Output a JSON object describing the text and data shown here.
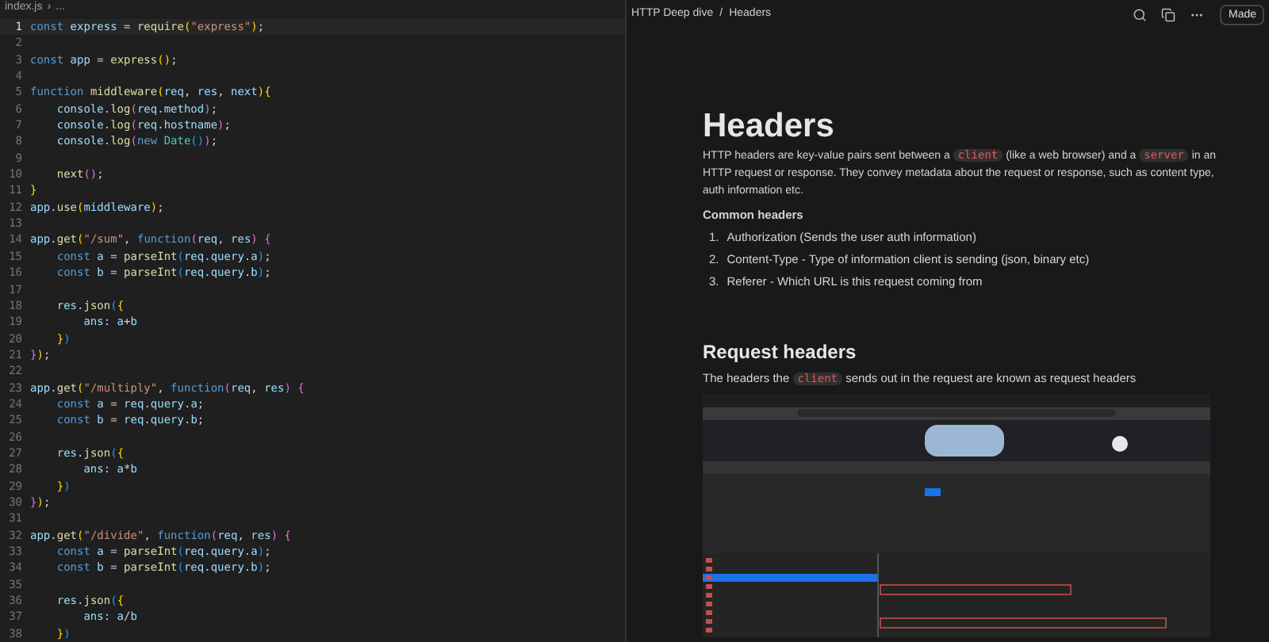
{
  "editor": {
    "breadcrumb": [
      {
        "text": "index.js"
      },
      {
        "text": "›"
      },
      {
        "text": "..."
      }
    ],
    "lines": [
      {
        "n": "1",
        "current": true,
        "t": [
          {
            "text": "const ",
            "kind": "keyword"
          },
          {
            "text": "express",
            "kind": "variable"
          },
          {
            "text": " = ",
            "kind": "punct"
          },
          {
            "text": "require",
            "kind": "function"
          },
          {
            "text": "(",
            "kind": "bracket1"
          },
          {
            "text": "\"express\"",
            "kind": "string"
          },
          {
            "text": ")",
            "kind": "bracket1"
          },
          {
            "text": ";",
            "kind": "punct"
          }
        ]
      },
      {
        "n": "2",
        "current": false
      },
      {
        "n": "3",
        "current": false,
        "t": [
          {
            "text": "const ",
            "kind": "keyword"
          },
          {
            "text": "app",
            "kind": "variable"
          },
          {
            "text": " = ",
            "kind": "punct"
          },
          {
            "text": "express",
            "kind": "function"
          },
          {
            "text": "()",
            "kind": "bracket1"
          },
          {
            "text": ";",
            "kind": "punct"
          }
        ]
      },
      {
        "n": "4",
        "current": false
      },
      {
        "n": "5",
        "current": false,
        "t": [
          {
            "text": "function ",
            "kind": "keyword"
          },
          {
            "text": "middleware",
            "kind": "function"
          },
          {
            "text": "(",
            "kind": "bracket1"
          },
          {
            "text": "req",
            "kind": "variable"
          },
          {
            "text": ", ",
            "kind": "punct"
          },
          {
            "text": "res",
            "kind": "variable"
          },
          {
            "text": ", ",
            "kind": "punct"
          },
          {
            "text": "next",
            "kind": "variable"
          },
          {
            "text": ")",
            "kind": "bracket1"
          },
          {
            "text": "{",
            "kind": "bracket1"
          }
        ]
      },
      {
        "n": "6",
        "current": false,
        "t": [
          {
            "text": "    console",
            "kind": "variable"
          },
          {
            "text": ".",
            "kind": "punct"
          },
          {
            "text": "log",
            "kind": "function"
          },
          {
            "text": "(",
            "kind": "bracket2"
          },
          {
            "text": "req",
            "kind": "variable"
          },
          {
            "text": ".",
            "kind": "punct"
          },
          {
            "text": "method",
            "kind": "variable"
          },
          {
            "text": ")",
            "kind": "bracket2"
          },
          {
            "text": ";",
            "kind": "punct"
          }
        ]
      },
      {
        "n": "7",
        "current": false,
        "t": [
          {
            "text": "    console",
            "kind": "variable"
          },
          {
            "text": ".",
            "kind": "punct"
          },
          {
            "text": "log",
            "kind": "function"
          },
          {
            "text": "(",
            "kind": "bracket2"
          },
          {
            "text": "req",
            "kind": "variable"
          },
          {
            "text": ".",
            "kind": "punct"
          },
          {
            "text": "hostname",
            "kind": "variable"
          },
          {
            "text": ")",
            "kind": "bracket2"
          },
          {
            "text": ";",
            "kind": "punct"
          }
        ]
      },
      {
        "n": "8",
        "current": false,
        "t": [
          {
            "text": "    console",
            "kind": "variable"
          },
          {
            "text": ".",
            "kind": "punct"
          },
          {
            "text": "log",
            "kind": "function"
          },
          {
            "text": "(",
            "kind": "bracket2"
          },
          {
            "text": "new ",
            "kind": "keyword"
          },
          {
            "text": "Date",
            "kind": "class"
          },
          {
            "text": "()",
            "kind": "bracket3"
          },
          {
            "text": ")",
            "kind": "bracket2"
          },
          {
            "text": ";",
            "kind": "punct"
          }
        ]
      },
      {
        "n": "9",
        "current": false
      },
      {
        "n": "10",
        "current": false,
        "t": [
          {
            "text": "    next",
            "kind": "function"
          },
          {
            "text": "()",
            "kind": "bracket2"
          },
          {
            "text": ";",
            "kind": "punct"
          }
        ]
      },
      {
        "n": "11",
        "current": false,
        "t": [
          {
            "text": "}",
            "kind": "bracket1"
          }
        ]
      },
      {
        "n": "12",
        "current": false,
        "t": [
          {
            "text": "app",
            "kind": "variable"
          },
          {
            "text": ".",
            "kind": "punct"
          },
          {
            "text": "use",
            "kind": "function"
          },
          {
            "text": "(",
            "kind": "bracket1"
          },
          {
            "text": "middleware",
            "kind": "variable"
          },
          {
            "text": ")",
            "kind": "bracket1"
          },
          {
            "text": ";",
            "kind": "punct"
          }
        ]
      },
      {
        "n": "13",
        "current": false
      },
      {
        "n": "14",
        "current": false,
        "t": [
          {
            "text": "app",
            "kind": "variable"
          },
          {
            "text": ".",
            "kind": "punct"
          },
          {
            "text": "get",
            "kind": "function"
          },
          {
            "text": "(",
            "kind": "bracket1"
          },
          {
            "text": "\"/sum\"",
            "kind": "string"
          },
          {
            "text": ", ",
            "kind": "punct"
          },
          {
            "text": "function",
            "kind": "keyword"
          },
          {
            "text": "(",
            "kind": "bracket2"
          },
          {
            "text": "req",
            "kind": "variable"
          },
          {
            "text": ", ",
            "kind": "punct"
          },
          {
            "text": "res",
            "kind": "variable"
          },
          {
            "text": ") {",
            "kind": "bracket2"
          }
        ]
      },
      {
        "n": "15",
        "current": false,
        "t": [
          {
            "text": "    const ",
            "kind": "keyword"
          },
          {
            "text": "a",
            "kind": "variable"
          },
          {
            "text": " = ",
            "kind": "punct"
          },
          {
            "text": "parseInt",
            "kind": "function"
          },
          {
            "text": "(",
            "kind": "bracket3"
          },
          {
            "text": "req",
            "kind": "variable"
          },
          {
            "text": ".",
            "kind": "punct"
          },
          {
            "text": "query",
            "kind": "variable"
          },
          {
            "text": ".",
            "kind": "punct"
          },
          {
            "text": "a",
            "kind": "variable"
          },
          {
            "text": ")",
            "kind": "bracket3"
          },
          {
            "text": ";",
            "kind": "punct"
          }
        ]
      },
      {
        "n": "16",
        "current": false,
        "t": [
          {
            "text": "    const ",
            "kind": "keyword"
          },
          {
            "text": "b",
            "kind": "variable"
          },
          {
            "text": " = ",
            "kind": "punct"
          },
          {
            "text": "parseInt",
            "kind": "function"
          },
          {
            "text": "(",
            "kind": "bracket3"
          },
          {
            "text": "req",
            "kind": "variable"
          },
          {
            "text": ".",
            "kind": "punct"
          },
          {
            "text": "query",
            "kind": "variable"
          },
          {
            "text": ".",
            "kind": "punct"
          },
          {
            "text": "b",
            "kind": "variable"
          },
          {
            "text": ")",
            "kind": "bracket3"
          },
          {
            "text": ";",
            "kind": "punct"
          }
        ]
      },
      {
        "n": "17",
        "current": false
      },
      {
        "n": "18",
        "current": false,
        "t": [
          {
            "text": "    res",
            "kind": "variable"
          },
          {
            "text": ".",
            "kind": "punct"
          },
          {
            "text": "json",
            "kind": "function"
          },
          {
            "text": "(",
            "kind": "bracket3"
          },
          {
            "text": "{",
            "kind": "bracket1"
          }
        ]
      },
      {
        "n": "19",
        "current": false,
        "t": [
          {
            "text": "        ans",
            "kind": "variable"
          },
          {
            "text": ": ",
            "kind": "punct"
          },
          {
            "text": "a",
            "kind": "variable"
          },
          {
            "text": "+",
            "kind": "punct"
          },
          {
            "text": "b",
            "kind": "variable"
          }
        ]
      },
      {
        "n": "20",
        "current": false,
        "t": [
          {
            "text": "    }",
            "kind": "bracket1"
          },
          {
            "text": ")",
            "kind": "bracket3"
          }
        ]
      },
      {
        "n": "21",
        "current": false,
        "t": [
          {
            "text": "}",
            "kind": "bracket2"
          },
          {
            "text": ")",
            "kind": "bracket1"
          },
          {
            "text": ";",
            "kind": "punct"
          }
        ]
      },
      {
        "n": "22",
        "current": false
      },
      {
        "n": "23",
        "current": false,
        "t": [
          {
            "text": "app",
            "kind": "variable"
          },
          {
            "text": ".",
            "kind": "punct"
          },
          {
            "text": "get",
            "kind": "function"
          },
          {
            "text": "(",
            "kind": "bracket1"
          },
          {
            "text": "\"/multiply\"",
            "kind": "string"
          },
          {
            "text": ", ",
            "kind": "punct"
          },
          {
            "text": "function",
            "kind": "keyword"
          },
          {
            "text": "(",
            "kind": "bracket2"
          },
          {
            "text": "req",
            "kind": "variable"
          },
          {
            "text": ", ",
            "kind": "punct"
          },
          {
            "text": "res",
            "kind": "variable"
          },
          {
            "text": ") {",
            "kind": "bracket2"
          }
        ]
      },
      {
        "n": "24",
        "current": false,
        "t": [
          {
            "text": "    const ",
            "kind": "keyword"
          },
          {
            "text": "a",
            "kind": "variable"
          },
          {
            "text": " = ",
            "kind": "punct"
          },
          {
            "text": "req",
            "kind": "variable"
          },
          {
            "text": ".",
            "kind": "punct"
          },
          {
            "text": "query",
            "kind": "variable"
          },
          {
            "text": ".",
            "kind": "punct"
          },
          {
            "text": "a",
            "kind": "variable"
          },
          {
            "text": ";",
            "kind": "punct"
          }
        ]
      },
      {
        "n": "25",
        "current": false,
        "t": [
          {
            "text": "    const ",
            "kind": "keyword"
          },
          {
            "text": "b",
            "kind": "variable"
          },
          {
            "text": " = ",
            "kind": "punct"
          },
          {
            "text": "req",
            "kind": "variable"
          },
          {
            "text": ".",
            "kind": "punct"
          },
          {
            "text": "query",
            "kind": "variable"
          },
          {
            "text": ".",
            "kind": "punct"
          },
          {
            "text": "b",
            "kind": "variable"
          },
          {
            "text": ";",
            "kind": "punct"
          }
        ]
      },
      {
        "n": "26",
        "current": false
      },
      {
        "n": "27",
        "current": false,
        "t": [
          {
            "text": "    res",
            "kind": "variable"
          },
          {
            "text": ".",
            "kind": "punct"
          },
          {
            "text": "json",
            "kind": "function"
          },
          {
            "text": "(",
            "kind": "bracket3"
          },
          {
            "text": "{",
            "kind": "bracket1"
          }
        ]
      },
      {
        "n": "28",
        "current": false,
        "t": [
          {
            "text": "        ans",
            "kind": "variable"
          },
          {
            "text": ": ",
            "kind": "punct"
          },
          {
            "text": "a",
            "kind": "variable"
          },
          {
            "text": "*",
            "kind": "punct"
          },
          {
            "text": "b",
            "kind": "variable"
          }
        ]
      },
      {
        "n": "29",
        "current": false,
        "t": [
          {
            "text": "    }",
            "kind": "bracket1"
          },
          {
            "text": ")",
            "kind": "bracket3"
          }
        ]
      },
      {
        "n": "30",
        "current": false,
        "t": [
          {
            "text": "}",
            "kind": "bracket2"
          },
          {
            "text": ")",
            "kind": "bracket1"
          },
          {
            "text": ";",
            "kind": "punct"
          }
        ]
      },
      {
        "n": "31",
        "current": false
      },
      {
        "n": "32",
        "current": false,
        "t": [
          {
            "text": "app",
            "kind": "variable"
          },
          {
            "text": ".",
            "kind": "punct"
          },
          {
            "text": "get",
            "kind": "function"
          },
          {
            "text": "(",
            "kind": "bracket1"
          },
          {
            "text": "\"/divide\"",
            "kind": "string"
          },
          {
            "text": ", ",
            "kind": "punct"
          },
          {
            "text": "function",
            "kind": "keyword"
          },
          {
            "text": "(",
            "kind": "bracket2"
          },
          {
            "text": "req",
            "kind": "variable"
          },
          {
            "text": ", ",
            "kind": "punct"
          },
          {
            "text": "res",
            "kind": "variable"
          },
          {
            "text": ") {",
            "kind": "bracket2"
          }
        ]
      },
      {
        "n": "33",
        "current": false,
        "t": [
          {
            "text": "    const ",
            "kind": "keyword"
          },
          {
            "text": "a",
            "kind": "variable"
          },
          {
            "text": " = ",
            "kind": "punct"
          },
          {
            "text": "parseInt",
            "kind": "function"
          },
          {
            "text": "(",
            "kind": "bracket3"
          },
          {
            "text": "req",
            "kind": "variable"
          },
          {
            "text": ".",
            "kind": "punct"
          },
          {
            "text": "query",
            "kind": "variable"
          },
          {
            "text": ".",
            "kind": "punct"
          },
          {
            "text": "a",
            "kind": "variable"
          },
          {
            "text": ")",
            "kind": "bracket3"
          },
          {
            "text": ";",
            "kind": "punct"
          }
        ]
      },
      {
        "n": "34",
        "current": false,
        "t": [
          {
            "text": "    const ",
            "kind": "keyword"
          },
          {
            "text": "b",
            "kind": "variable"
          },
          {
            "text": " = ",
            "kind": "punct"
          },
          {
            "text": "parseInt",
            "kind": "function"
          },
          {
            "text": "(",
            "kind": "bracket3"
          },
          {
            "text": "req",
            "kind": "variable"
          },
          {
            "text": ".",
            "kind": "punct"
          },
          {
            "text": "query",
            "kind": "variable"
          },
          {
            "text": ".",
            "kind": "punct"
          },
          {
            "text": "b",
            "kind": "variable"
          },
          {
            "text": ")",
            "kind": "bracket3"
          },
          {
            "text": ";",
            "kind": "punct"
          }
        ]
      },
      {
        "n": "35",
        "current": false
      },
      {
        "n": "36",
        "current": false,
        "t": [
          {
            "text": "    res",
            "kind": "variable"
          },
          {
            "text": ".",
            "kind": "punct"
          },
          {
            "text": "json",
            "kind": "function"
          },
          {
            "text": "(",
            "kind": "bracket3"
          },
          {
            "text": "{",
            "kind": "bracket1"
          }
        ]
      },
      {
        "n": "37",
        "current": false,
        "t": [
          {
            "text": "        ans",
            "kind": "variable"
          },
          {
            "text": ": ",
            "kind": "punct"
          },
          {
            "text": "a",
            "kind": "variable"
          },
          {
            "text": "/",
            "kind": "punct"
          },
          {
            "text": "b",
            "kind": "variable"
          }
        ]
      },
      {
        "n": "38",
        "current": false,
        "t": [
          {
            "text": "    }",
            "kind": "bracket1"
          },
          {
            "text": ")",
            "kind": "bracket3"
          }
        ]
      }
    ]
  },
  "doc": {
    "breadcrumb": [
      "HTTP Deep dive",
      "/",
      "Headers"
    ],
    "made_button": "Made",
    "title": "Headers",
    "intro": [
      {
        "kind": "text",
        "text": "HTTP headers are key-value pairs sent between a "
      },
      {
        "kind": "code",
        "text": "client"
      },
      {
        "kind": "text",
        "text": " (like a web browser) and a "
      },
      {
        "kind": "code",
        "text": "server"
      },
      {
        "kind": "text",
        "text": " in an HTTP request or response. They convey metadata about the request or response, such as content type, auth information etc."
      }
    ],
    "common_heading": "Common headers",
    "list": [
      {
        "num": "1.",
        "text": "Authorization (Sends the user auth information)"
      },
      {
        "num": "2.",
        "text": "Content-Type - Type of information client is sending (json, binary etc)"
      },
      {
        "num": "3.",
        "text": "Referer - Which URL is this request coming from"
      }
    ],
    "section_heading": "Request headers",
    "section_text": [
      {
        "kind": "text",
        "text": "The headers the "
      },
      {
        "kind": "code",
        "text": "client"
      },
      {
        "kind": "text",
        "text": " sends out in the request are known as request headers"
      }
    ]
  }
}
